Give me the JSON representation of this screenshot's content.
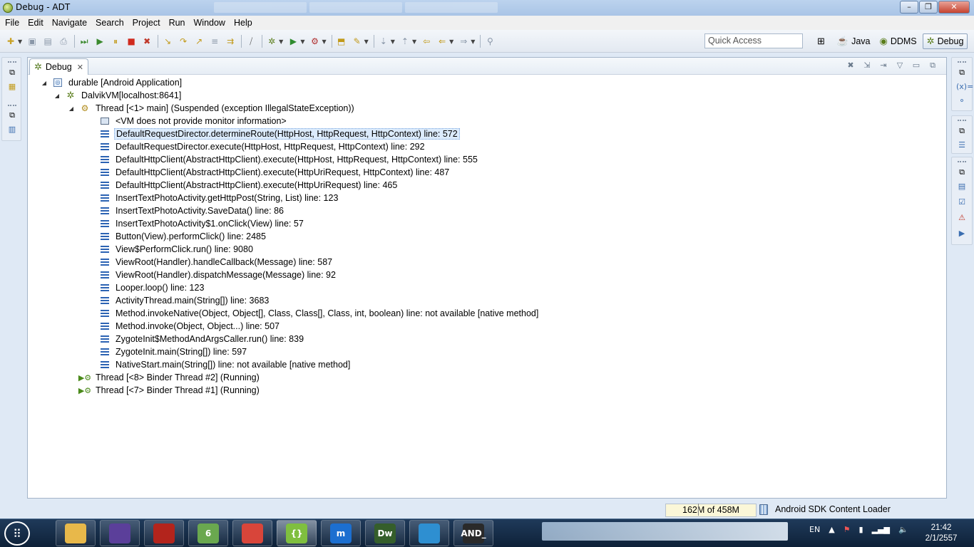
{
  "window": {
    "title": "Debug - ADT",
    "minimize": "–",
    "maximize": "❐",
    "close": "✕"
  },
  "menu": [
    "File",
    "Edit",
    "Navigate",
    "Search",
    "Project",
    "Run",
    "Window",
    "Help"
  ],
  "toolbar": {
    "quick_access_placeholder": "Quick Access",
    "perspectives": [
      {
        "label": "Java",
        "icon": "java-icon"
      },
      {
        "label": "DDMS",
        "icon": "ddms-icon"
      },
      {
        "label": "Debug",
        "icon": "debug-icon",
        "active": true
      }
    ]
  },
  "debug_view": {
    "tab_label": "Debug",
    "tab_close": "✕",
    "tree": [
      {
        "level": 0,
        "twisty": "◢",
        "icon": "app",
        "label": "durable [Android Application]"
      },
      {
        "level": 1,
        "twisty": "◢",
        "icon": "vm",
        "label": "DalvikVM[localhost:8641]"
      },
      {
        "level": 2,
        "twisty": "◢",
        "icon": "thread",
        "label": "Thread [<1> main] (Suspended (exception IllegalStateException))"
      },
      {
        "level": 3,
        "twisty": "",
        "icon": "monitor",
        "label": "<VM does not provide monitor information>"
      },
      {
        "level": 3,
        "twisty": "",
        "icon": "frame",
        "label": "DefaultRequestDirector.determineRoute(HttpHost, HttpRequest, HttpContext) line: 572",
        "selected": true
      },
      {
        "level": 3,
        "twisty": "",
        "icon": "frame",
        "label": "DefaultRequestDirector.execute(HttpHost, HttpRequest, HttpContext) line: 292"
      },
      {
        "level": 3,
        "twisty": "",
        "icon": "frame",
        "label": "DefaultHttpClient(AbstractHttpClient).execute(HttpHost, HttpRequest, HttpContext) line: 555"
      },
      {
        "level": 3,
        "twisty": "",
        "icon": "frame",
        "label": "DefaultHttpClient(AbstractHttpClient).execute(HttpUriRequest, HttpContext) line: 487"
      },
      {
        "level": 3,
        "twisty": "",
        "icon": "frame",
        "label": "DefaultHttpClient(AbstractHttpClient).execute(HttpUriRequest) line: 465"
      },
      {
        "level": 3,
        "twisty": "",
        "icon": "frame",
        "label": "InsertTextPhotoActivity.getHttpPost(String, List) line: 123"
      },
      {
        "level": 3,
        "twisty": "",
        "icon": "frame",
        "label": "InsertTextPhotoActivity.SaveData() line: 86"
      },
      {
        "level": 3,
        "twisty": "",
        "icon": "frame",
        "label": "InsertTextPhotoActivity$1.onClick(View) line: 57"
      },
      {
        "level": 3,
        "twisty": "",
        "icon": "frame",
        "label": "Button(View).performClick() line: 2485"
      },
      {
        "level": 3,
        "twisty": "",
        "icon": "frame",
        "label": "View$PerformClick.run() line: 9080"
      },
      {
        "level": 3,
        "twisty": "",
        "icon": "frame",
        "label": "ViewRoot(Handler).handleCallback(Message) line: 587"
      },
      {
        "level": 3,
        "twisty": "",
        "icon": "frame",
        "label": "ViewRoot(Handler).dispatchMessage(Message) line: 92"
      },
      {
        "level": 3,
        "twisty": "",
        "icon": "frame",
        "label": "Looper.loop() line: 123"
      },
      {
        "level": 3,
        "twisty": "",
        "icon": "frame",
        "label": "ActivityThread.main(String[]) line: 3683"
      },
      {
        "level": 3,
        "twisty": "",
        "icon": "frame",
        "label": "Method.invokeNative(Object, Object[], Class, Class[], Class, int, boolean) line: not available [native method]"
      },
      {
        "level": 3,
        "twisty": "",
        "icon": "frame",
        "label": "Method.invoke(Object, Object...) line: 507"
      },
      {
        "level": 3,
        "twisty": "",
        "icon": "frame",
        "label": "ZygoteInit$MethodAndArgsCaller.run() line: 839"
      },
      {
        "level": 3,
        "twisty": "",
        "icon": "frame",
        "label": "ZygoteInit.main(String[]) line: 597"
      },
      {
        "level": 3,
        "twisty": "",
        "icon": "frame",
        "label": "NativeStart.main(String[]) line: not available [native method]"
      },
      {
        "level": 2,
        "twisty": "",
        "icon": "running",
        "label": "Thread [<8> Binder Thread #2] (Running)"
      },
      {
        "level": 2,
        "twisty": "",
        "icon": "running",
        "label": "Thread [<7> Binder Thread #1] (Running)"
      }
    ]
  },
  "status": {
    "heap": "162M of 458M",
    "heap_used_fraction": 0.354,
    "job": "Android SDK Content Loader"
  },
  "taskbar": {
    "apps": [
      {
        "name": "file-explorer",
        "glyph": "",
        "color": "#e8b84a"
      },
      {
        "name": "eclipse",
        "glyph": "",
        "color": "#5b3f9a"
      },
      {
        "name": "red-app",
        "glyph": "",
        "color": "#b3241c"
      },
      {
        "name": "green-app",
        "glyph": "6",
        "color": "#6aa84f"
      },
      {
        "name": "swirl-app",
        "glyph": "",
        "color": "#d8453a"
      },
      {
        "name": "brackets",
        "glyph": "{}",
        "color": "#7fbf3f"
      },
      {
        "name": "maxthon",
        "glyph": "m",
        "color": "#1c6fd0"
      },
      {
        "name": "dreamweaver",
        "glyph": "Dw",
        "color": "#355e2b"
      },
      {
        "name": "messenger",
        "glyph": "",
        "color": "#2e8fd1"
      },
      {
        "name": "android",
        "glyph": "AND_",
        "color": "#2a2a2a"
      }
    ],
    "lang": "EN",
    "time": "21:42",
    "date": "2/1/2557"
  }
}
